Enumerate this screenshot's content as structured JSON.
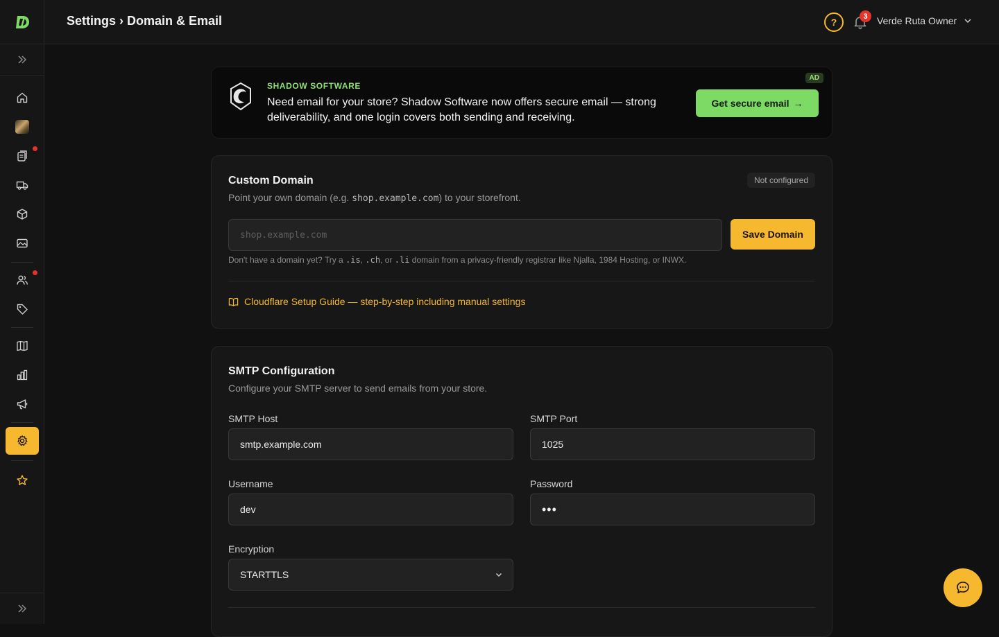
{
  "header": {
    "breadcrumb": "Settings › Domain & Email",
    "notifications_count": "3",
    "user_name": "Verde Ruta Owner",
    "help_glyph": "?"
  },
  "sidebar": {
    "items": [
      {
        "icon": "home-icon"
      },
      {
        "icon": "store-avatar"
      },
      {
        "icon": "orders-icon",
        "dot": true
      },
      {
        "icon": "truck-icon"
      },
      {
        "icon": "box-icon"
      },
      {
        "icon": "image-icon"
      },
      {
        "icon": "users-icon",
        "dot": true
      },
      {
        "icon": "tag-icon"
      },
      {
        "icon": "book-icon"
      },
      {
        "icon": "chart-icon"
      },
      {
        "icon": "megaphone-icon"
      },
      {
        "icon": "gear-icon",
        "active": true
      },
      {
        "icon": "star-icon"
      }
    ]
  },
  "ad": {
    "brand": "SHADOW SOFTWARE",
    "text": "Need email for your store? Shadow Software now offers secure email — strong deliverability, and one login covers both sending and receiving.",
    "badge": "AD",
    "cta_label": "Get secure email",
    "cta_arrow": "→"
  },
  "domain": {
    "title": "Custom Domain",
    "subtitle_before": "Point your own domain (e.g. ",
    "subtitle_code": "shop.example.com",
    "subtitle_after": ") to your storefront.",
    "status": "Not configured",
    "input_placeholder": "shop.example.com",
    "save_label": "Save Domain",
    "hint_1": "Don't have a domain yet? Try a ",
    "hint_tld_1": ".is",
    "hint_2": ", ",
    "hint_tld_2": ".ch",
    "hint_3": ", or ",
    "hint_tld_3": ".li",
    "hint_4": " domain from a privacy-friendly registrar like Njalla, 1984 Hosting, or INWX.",
    "guide_link": "Cloudflare Setup Guide — step-by-step including manual settings"
  },
  "smtp": {
    "title": "SMTP Configuration",
    "subtitle": "Configure your SMTP server to send emails from your store.",
    "host_label": "SMTP Host",
    "host_value": "smtp.example.com",
    "port_label": "SMTP Port",
    "port_value": "1025",
    "username_label": "Username",
    "username_value": "dev",
    "password_label": "Password",
    "password_value": "•••",
    "encryption_label": "Encryption",
    "encryption_value": "STARTTLS"
  },
  "colors": {
    "accent": "#f5b82e",
    "ad_green": "#7ddb65",
    "background": "#111111"
  }
}
